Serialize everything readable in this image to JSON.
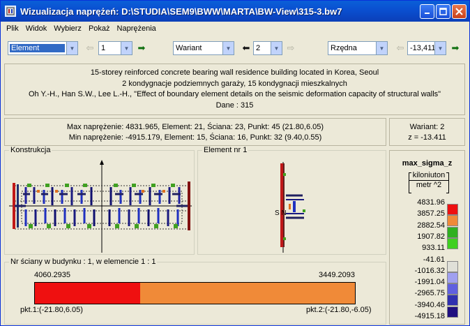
{
  "window": {
    "title": "Wizualizacja naprężeń: D:\\STUDIA\\SEM9\\BWW\\MARTA\\BW-View\\315-3.bw7"
  },
  "menu": [
    "Plik",
    "Widok",
    "Wybierz",
    "Pokaż",
    "Naprężenia"
  ],
  "toolbar": {
    "element_select": "Element",
    "element_value": "1",
    "wariant_select": "Wariant",
    "wariant_value": "2",
    "rzedna_select": "Rzędna",
    "rzedna_value": "-13,411"
  },
  "info": {
    "line1": "15-storey reinforced concrete bearing wall residence building located in Korea, Seoul",
    "line2": "2 kondygnacje podziemnych garaży, 15 kondygnacji mieszkalnych",
    "line3": "Oh Y.-H., Han S.W., Lee L.-H., \"Effect of boundary element details on the seismic deformation capacity of structural walls\"",
    "line4": "Dane :   315"
  },
  "stats": {
    "max": "Max naprężenie: 4831.965,   Element: 21,   Ściana: 23,   Punkt: 45 (21.80,6.05)",
    "min": "Min naprężenie: -4915.179,   Element: 15,   Ściana: 16,   Punkt: 32 (9.40,0.55)"
  },
  "variant": {
    "wariant": "Wariant: 2",
    "z": "z = -13.411"
  },
  "panels": {
    "konstrukcja": "Konstrukcja",
    "element": "Element nr 1",
    "element_node_label": "S  N",
    "nr_sciany": "Nr ściany w budynku :  1,    w elemencie 1 :  1"
  },
  "wall_bar": {
    "left_value": "4060.2935",
    "right_value": "3449.2093",
    "split_fraction": 0.33,
    "left_color": "#ef1010",
    "right_color": "#f08a38",
    "pkt1": "pkt.1:(-21.80,6.05)",
    "pkt2": "pkt.2:(-21.80,-6.05)"
  },
  "legend": {
    "title": "max_sigma_z",
    "unit_top": "kiloniuton",
    "unit_bottom": "metr ^2",
    "labels": [
      "4831.96",
      "3857.25",
      "2882.54",
      "1907.82",
      "933.11",
      "-41.61",
      "-1016.32",
      "-1991.04",
      "-2965.75",
      "-3940.46",
      "-4915.18"
    ],
    "colors": [
      "#ee1010",
      "#f08a38",
      "#30b020",
      "#40d020",
      "#e0e0d8",
      "#a0a0f0",
      "#6060e0",
      "#3030b0",
      "#201080"
    ]
  }
}
